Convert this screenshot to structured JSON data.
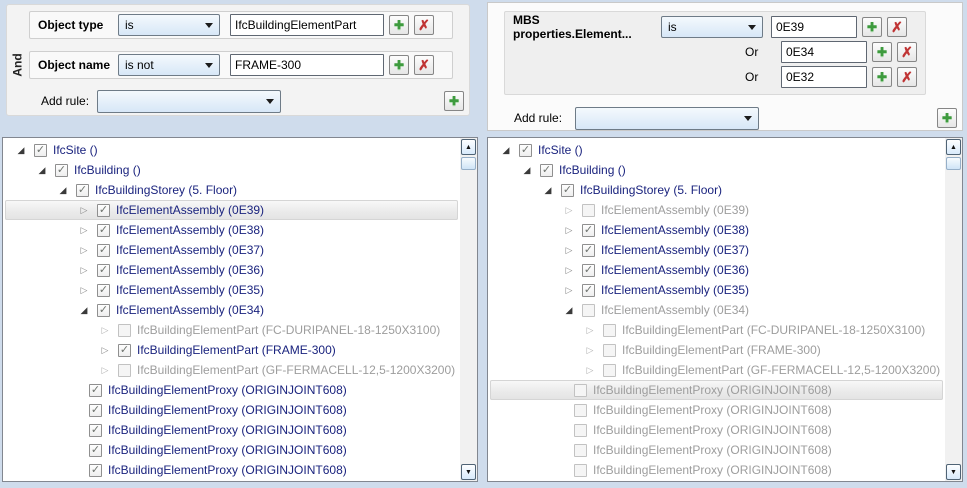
{
  "colors": {
    "tree_text_blue": "#1a237e",
    "tree_text_gray": "#9d9d9d",
    "plus_green": "#3e9b3e",
    "x_red": "#c03434",
    "selection_gray": "#e3e3e3",
    "combo_blue": "#d7e7f7",
    "page_background": "#cfdcec"
  },
  "left_filter": {
    "logic_label": "And",
    "add_rule_label": "Add rule:",
    "add_rule_selected": "",
    "rules": [
      {
        "field": "Object type",
        "operator": "is",
        "value": "IfcBuildingElementPart"
      },
      {
        "field": "Object name",
        "operator": "is not",
        "value": "FRAME-300"
      }
    ]
  },
  "right_filter": {
    "field": "MBS properties.Element...",
    "operator": "is",
    "or_label": "Or",
    "values": [
      "0E39",
      "0E34",
      "0E32"
    ],
    "add_rule_label": "Add rule:",
    "add_rule_selected": ""
  },
  "left_tree": {
    "rows": [
      {
        "label": "IfcSite ()",
        "level": 0,
        "expander": "expanded",
        "checked": true,
        "enabled": true,
        "selected": false
      },
      {
        "label": "IfcBuilding ()",
        "level": 1,
        "expander": "expanded",
        "checked": true,
        "enabled": true,
        "selected": false
      },
      {
        "label": "IfcBuildingStorey (5. Floor)",
        "level": 2,
        "expander": "expanded",
        "checked": true,
        "enabled": true,
        "selected": false
      },
      {
        "label": "IfcElementAssembly (0E39)",
        "level": 3,
        "expander": "collapsed",
        "checked": true,
        "enabled": true,
        "selected": true
      },
      {
        "label": "IfcElementAssembly (0E38)",
        "level": 3,
        "expander": "collapsed",
        "checked": true,
        "enabled": true,
        "selected": false
      },
      {
        "label": "IfcElementAssembly (0E37)",
        "level": 3,
        "expander": "collapsed",
        "checked": true,
        "enabled": true,
        "selected": false
      },
      {
        "label": "IfcElementAssembly (0E36)",
        "level": 3,
        "expander": "collapsed",
        "checked": true,
        "enabled": true,
        "selected": false
      },
      {
        "label": "IfcElementAssembly (0E35)",
        "level": 3,
        "expander": "collapsed",
        "checked": true,
        "enabled": true,
        "selected": false
      },
      {
        "label": "IfcElementAssembly (0E34)",
        "level": 3,
        "expander": "expanded",
        "checked": true,
        "enabled": true,
        "selected": false
      },
      {
        "label": "IfcBuildingElementPart (FC-DURIPANEL-18-1250X3100)",
        "level": 4,
        "expander": "collapsed",
        "checked": false,
        "enabled": false,
        "selected": false
      },
      {
        "label": "IfcBuildingElementPart (FRAME-300)",
        "level": 4,
        "expander": "collapsed",
        "checked": true,
        "enabled": true,
        "selected": false
      },
      {
        "label": "IfcBuildingElementPart (GF-FERMACELL-12,5-1200X3200)",
        "level": 4,
        "expander": "collapsed",
        "checked": false,
        "enabled": false,
        "selected": false
      },
      {
        "label": "IfcBuildingElementProxy (ORIGINJOINT608)",
        "level": 4,
        "expander": "none",
        "checked": true,
        "enabled": true,
        "selected": false
      },
      {
        "label": "IfcBuildingElementProxy (ORIGINJOINT608)",
        "level": 4,
        "expander": "none",
        "checked": true,
        "enabled": true,
        "selected": false
      },
      {
        "label": "IfcBuildingElementProxy (ORIGINJOINT608)",
        "level": 4,
        "expander": "none",
        "checked": true,
        "enabled": true,
        "selected": false
      },
      {
        "label": "IfcBuildingElementProxy (ORIGINJOINT608)",
        "level": 4,
        "expander": "none",
        "checked": true,
        "enabled": true,
        "selected": false
      },
      {
        "label": "IfcBuildingElementProxy (ORIGINJOINT608)",
        "level": 4,
        "expander": "none",
        "checked": true,
        "enabled": true,
        "selected": false
      }
    ]
  },
  "right_tree": {
    "rows": [
      {
        "label": "IfcSite ()",
        "level": 0,
        "expander": "expanded",
        "checked": true,
        "enabled": true,
        "selected": false
      },
      {
        "label": "IfcBuilding ()",
        "level": 1,
        "expander": "expanded",
        "checked": true,
        "enabled": true,
        "selected": false
      },
      {
        "label": "IfcBuildingStorey (5. Floor)",
        "level": 2,
        "expander": "expanded",
        "checked": true,
        "enabled": true,
        "selected": false
      },
      {
        "label": "IfcElementAssembly (0E39)",
        "level": 3,
        "expander": "collapsed",
        "checked": false,
        "enabled": false,
        "selected": false
      },
      {
        "label": "IfcElementAssembly (0E38)",
        "level": 3,
        "expander": "collapsed",
        "checked": true,
        "enabled": true,
        "selected": false
      },
      {
        "label": "IfcElementAssembly (0E37)",
        "level": 3,
        "expander": "collapsed",
        "checked": true,
        "enabled": true,
        "selected": false
      },
      {
        "label": "IfcElementAssembly (0E36)",
        "level": 3,
        "expander": "collapsed",
        "checked": true,
        "enabled": true,
        "selected": false
      },
      {
        "label": "IfcElementAssembly (0E35)",
        "level": 3,
        "expander": "collapsed",
        "checked": true,
        "enabled": true,
        "selected": false
      },
      {
        "label": "IfcElementAssembly (0E34)",
        "level": 3,
        "expander": "expanded",
        "checked": false,
        "enabled": false,
        "selected": false
      },
      {
        "label": "IfcBuildingElementPart (FC-DURIPANEL-18-1250X3100)",
        "level": 4,
        "expander": "collapsed",
        "checked": false,
        "enabled": false,
        "selected": false
      },
      {
        "label": "IfcBuildingElementPart (FRAME-300)",
        "level": 4,
        "expander": "collapsed",
        "checked": false,
        "enabled": false,
        "selected": false
      },
      {
        "label": "IfcBuildingElementPart (GF-FERMACELL-12,5-1200X3200)",
        "level": 4,
        "expander": "collapsed",
        "checked": false,
        "enabled": false,
        "selected": false
      },
      {
        "label": "IfcBuildingElementProxy (ORIGINJOINT608)",
        "level": 4,
        "expander": "none",
        "checked": false,
        "enabled": false,
        "selected": true
      },
      {
        "label": "IfcBuildingElementProxy (ORIGINJOINT608)",
        "level": 4,
        "expander": "none",
        "checked": false,
        "enabled": false,
        "selected": false
      },
      {
        "label": "IfcBuildingElementProxy (ORIGINJOINT608)",
        "level": 4,
        "expander": "none",
        "checked": false,
        "enabled": false,
        "selected": false
      },
      {
        "label": "IfcBuildingElementProxy (ORIGINJOINT608)",
        "level": 4,
        "expander": "none",
        "checked": false,
        "enabled": false,
        "selected": false
      },
      {
        "label": "IfcBuildingElementProxy (ORIGINJOINT608)",
        "level": 4,
        "expander": "none",
        "checked": false,
        "enabled": false,
        "selected": false
      }
    ]
  }
}
